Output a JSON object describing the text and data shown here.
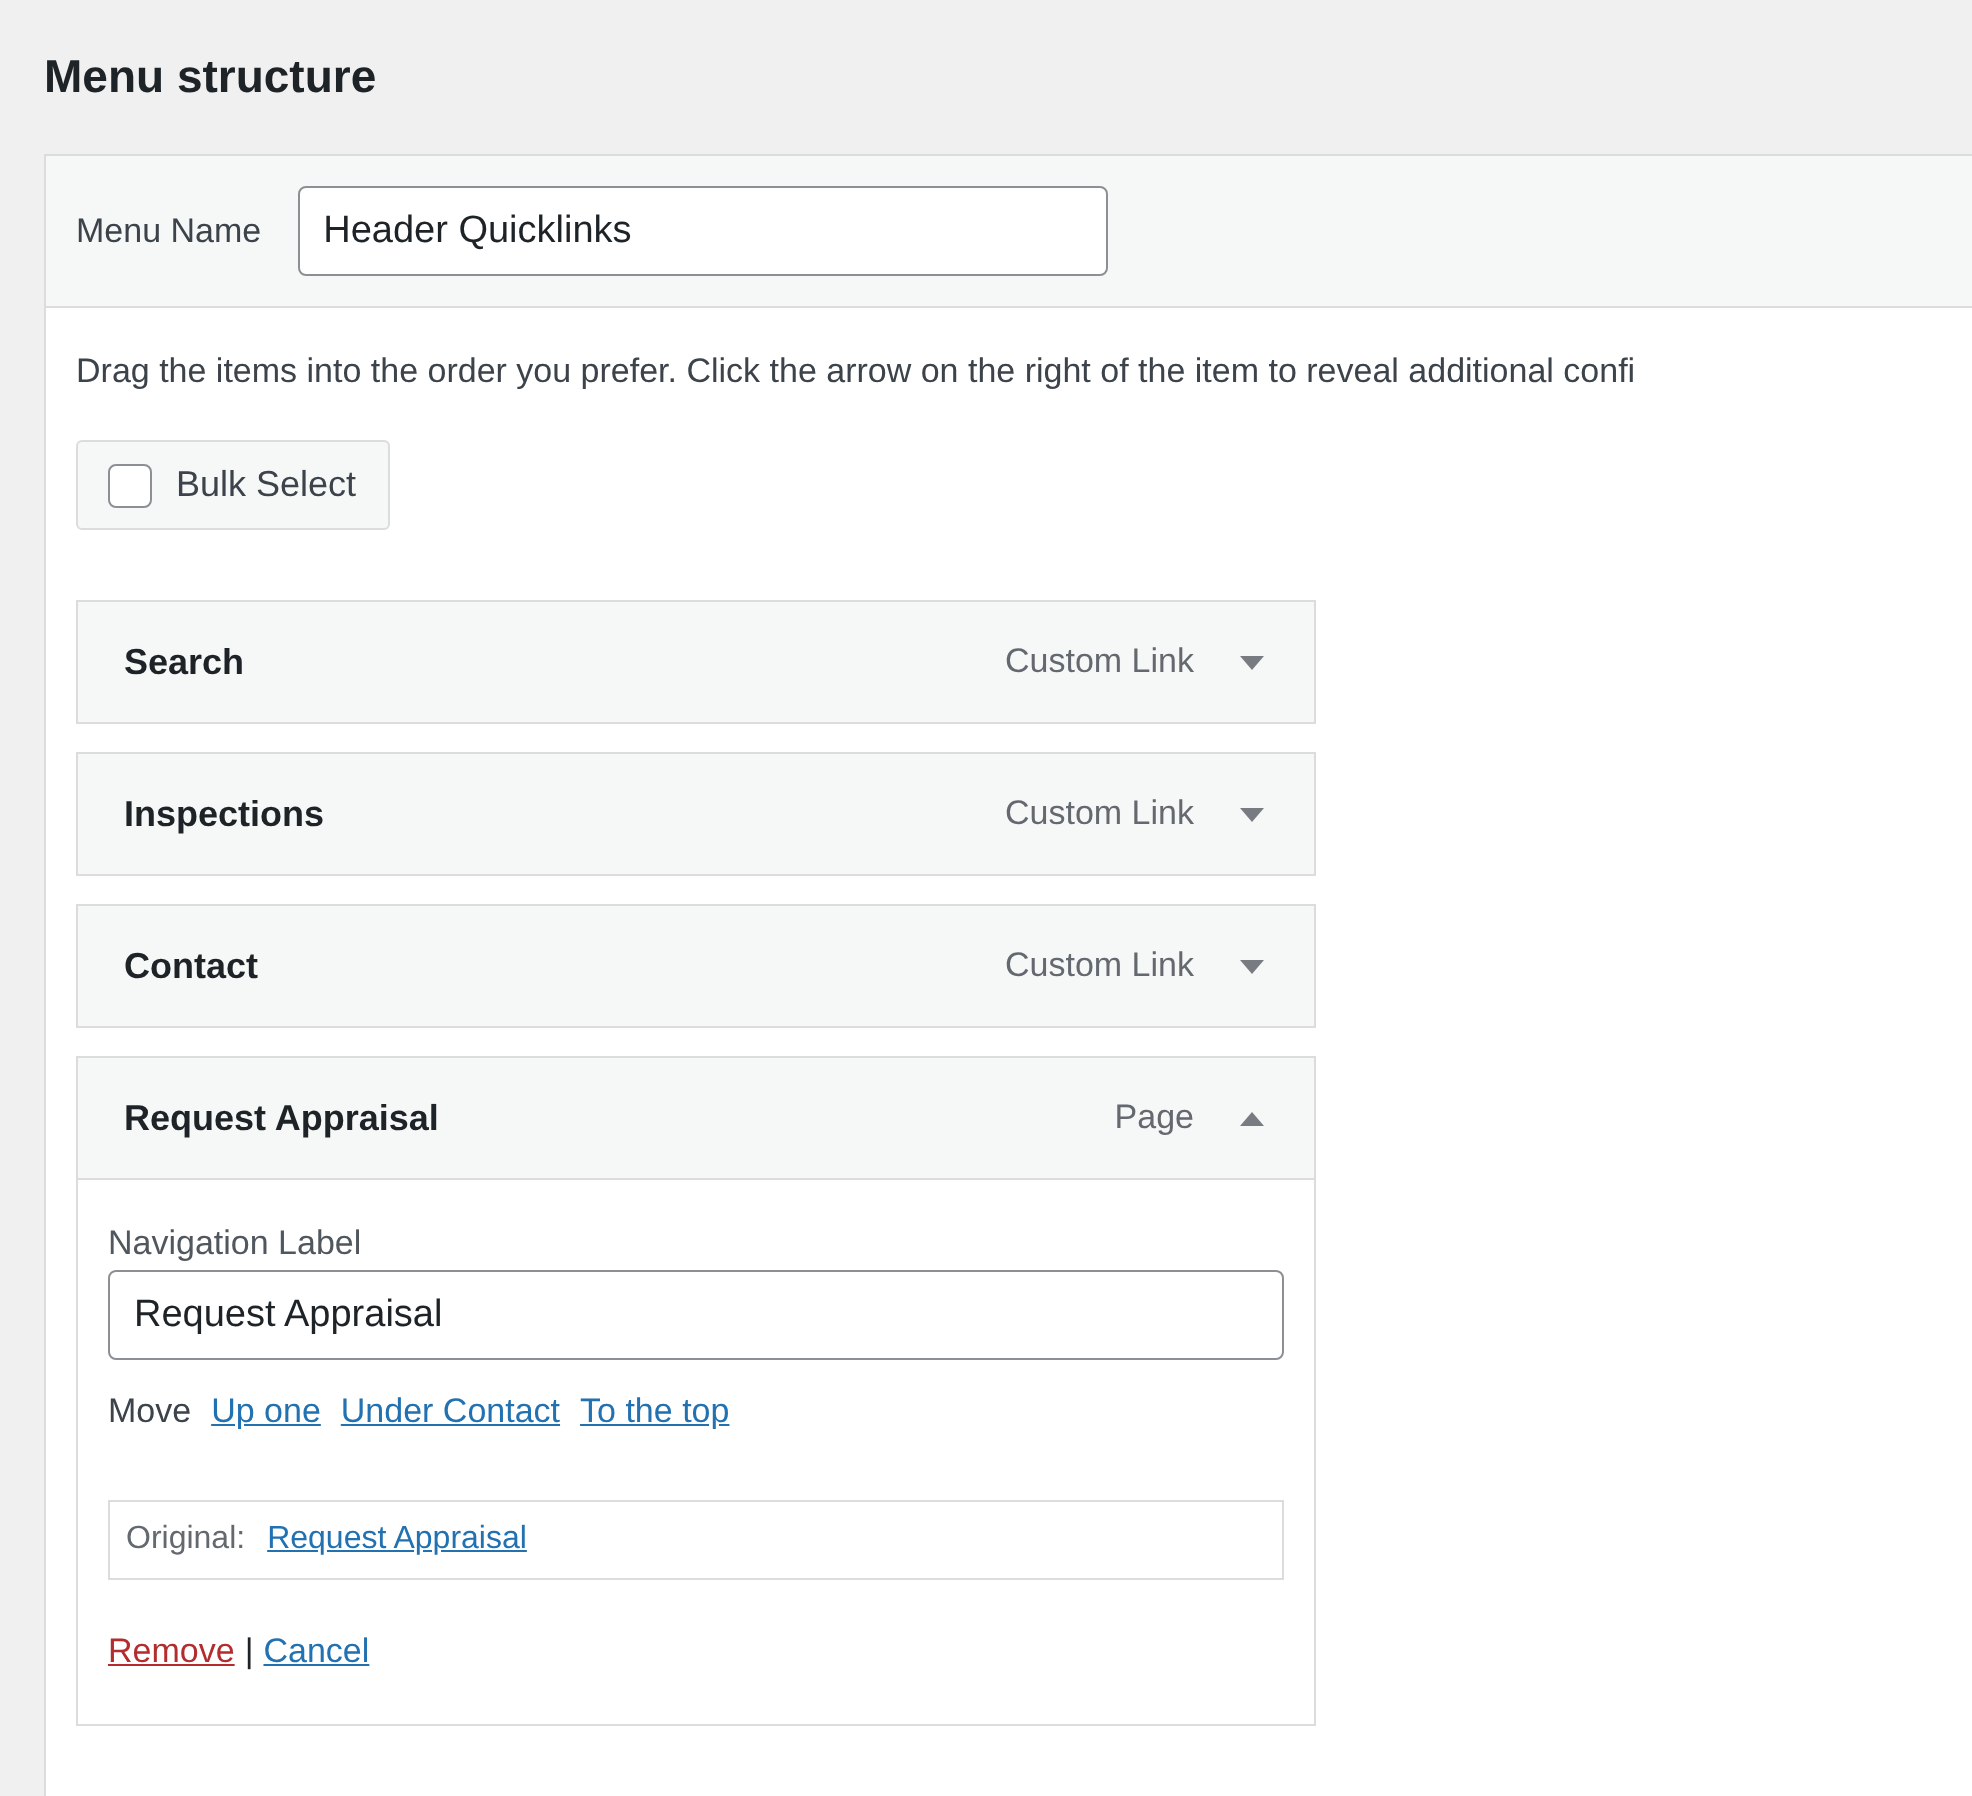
{
  "title": "Menu structure",
  "menu_name": {
    "label": "Menu Name",
    "value": "Header Quicklinks"
  },
  "instructions": "Drag the items into the order you prefer. Click the arrow on the right of the item to reveal additional confi",
  "bulk_select": {
    "label": "Bulk Select",
    "checked": false
  },
  "items": [
    {
      "title": "Search",
      "type": "Custom Link",
      "expanded": false
    },
    {
      "title": "Inspections",
      "type": "Custom Link",
      "expanded": false
    },
    {
      "title": "Contact",
      "type": "Custom Link",
      "expanded": false
    },
    {
      "title": "Request Appraisal",
      "type": "Page",
      "expanded": true,
      "settings": {
        "navigation_label": {
          "label": "Navigation Label",
          "value": "Request Appraisal"
        },
        "move": {
          "label": "Move",
          "links": [
            "Up one",
            "Under Contact",
            "To the top"
          ]
        },
        "original": {
          "label": "Original:",
          "link": "Request Appraisal"
        },
        "actions": [
          {
            "label": "Remove",
            "kind": "delete"
          },
          {
            "label": "Cancel",
            "kind": "cancel"
          }
        ],
        "separator": "|"
      }
    }
  ]
}
